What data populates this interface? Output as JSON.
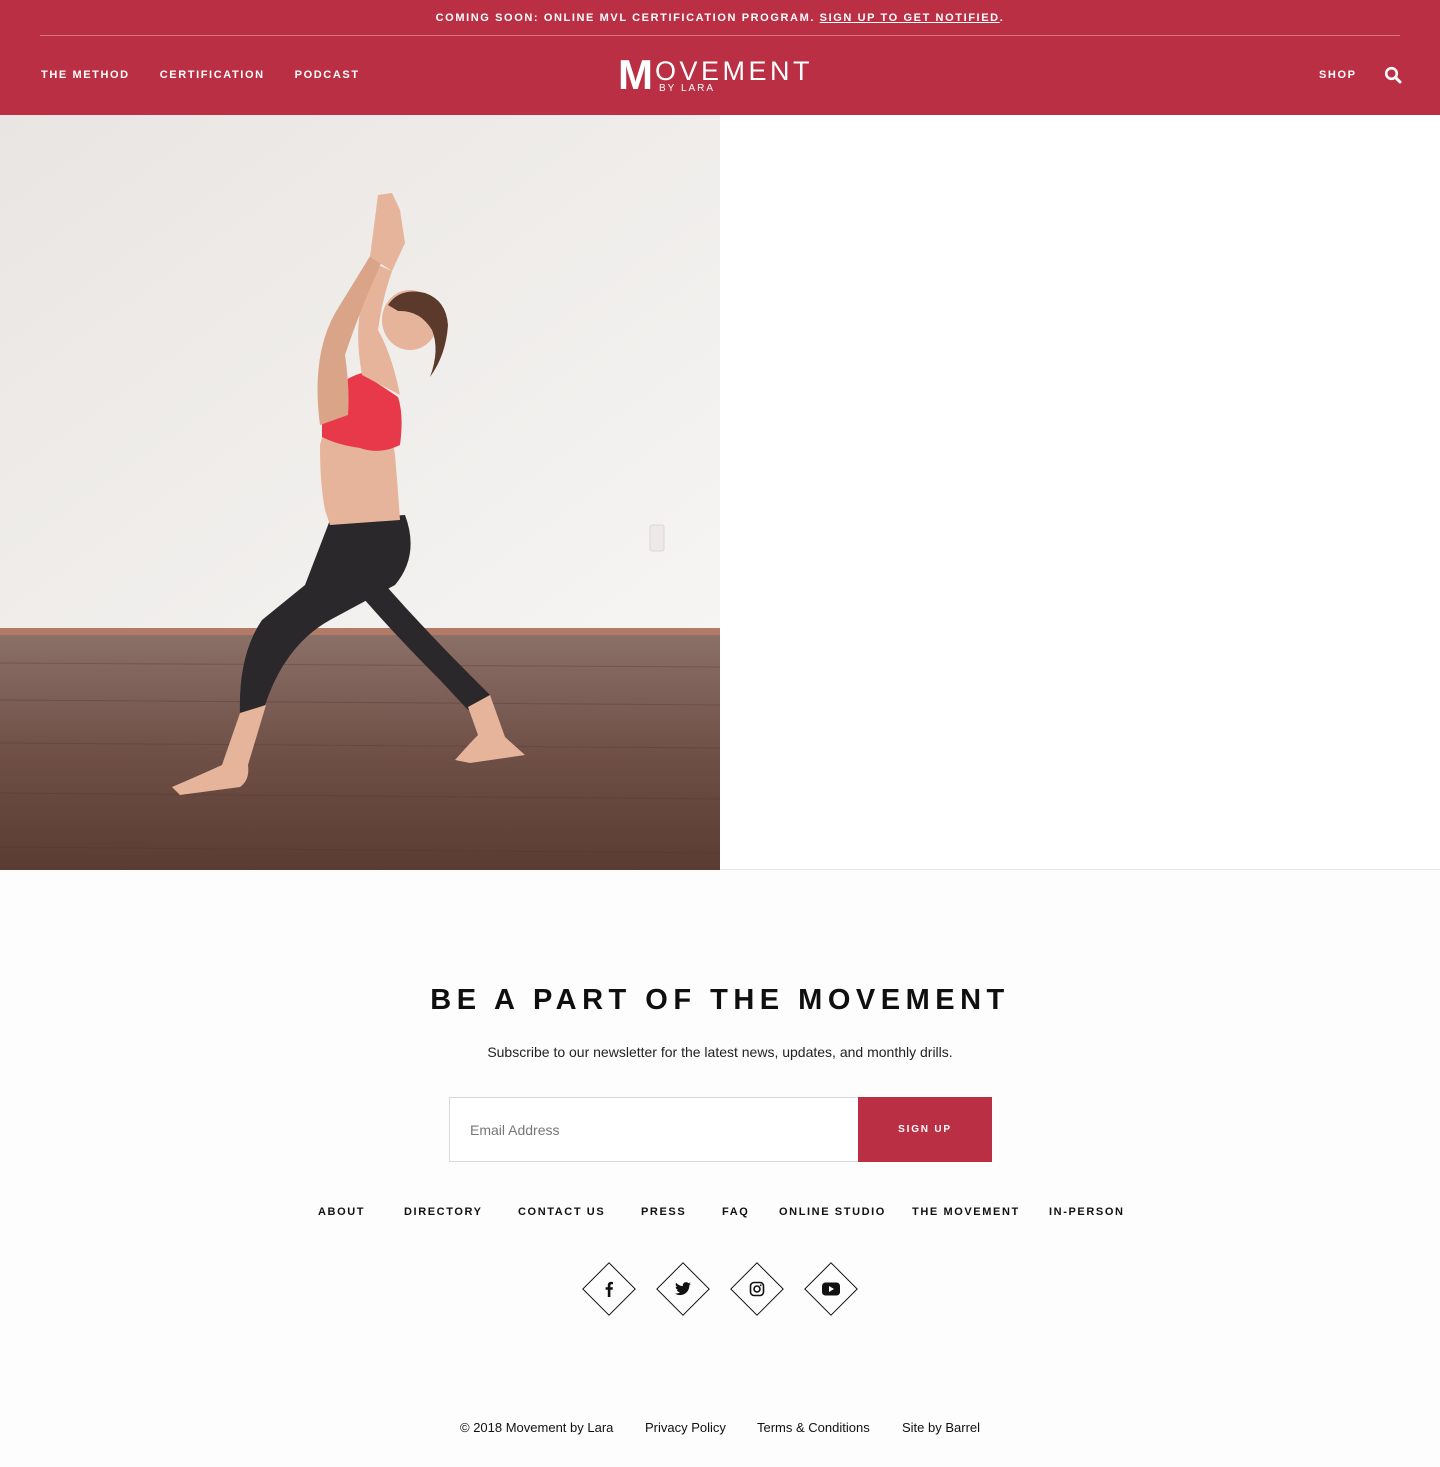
{
  "announcement": {
    "text": "COMING SOON: ONLINE MVL CERTIFICATION PROGRAM.",
    "link_label": "SIGN UP TO GET NOTIFIED",
    "suffix": "."
  },
  "nav": {
    "left": [
      "THE METHOD",
      "CERTIFICATION",
      "PODCAST"
    ],
    "shop": "SHOP",
    "search_icon": "search-icon"
  },
  "logo": {
    "initial": "M",
    "word": "OVEMENT",
    "sub": "BY LARA"
  },
  "hero": {
    "image": "woman-in-red-sports-bra-and-black-leggings-doing-high-lunge-arms-overhead"
  },
  "newsletter": {
    "title": "BE A PART OF THE MOVEMENT",
    "subtitle": "Subscribe to our newsletter for the latest news, updates, and monthly drills.",
    "email_placeholder": "Email Address",
    "button": "SIGN UP"
  },
  "footer_nav": [
    "ABOUT",
    "DIRECTORY",
    "CONTACT US",
    "PRESS",
    "FAQ",
    "ONLINE STUDIO",
    "THE MOVEMENT",
    "IN-PERSON"
  ],
  "social": [
    "facebook-icon",
    "twitter-icon",
    "instagram-icon",
    "youtube-icon"
  ],
  "legal": [
    "© 2018 Movement by Lara",
    "Privacy Policy",
    "Terms & Conditions",
    "Site by Barrel"
  ],
  "colors": {
    "brand": "#bb2f44",
    "text": "#111111",
    "background": "#fdfdfd"
  }
}
